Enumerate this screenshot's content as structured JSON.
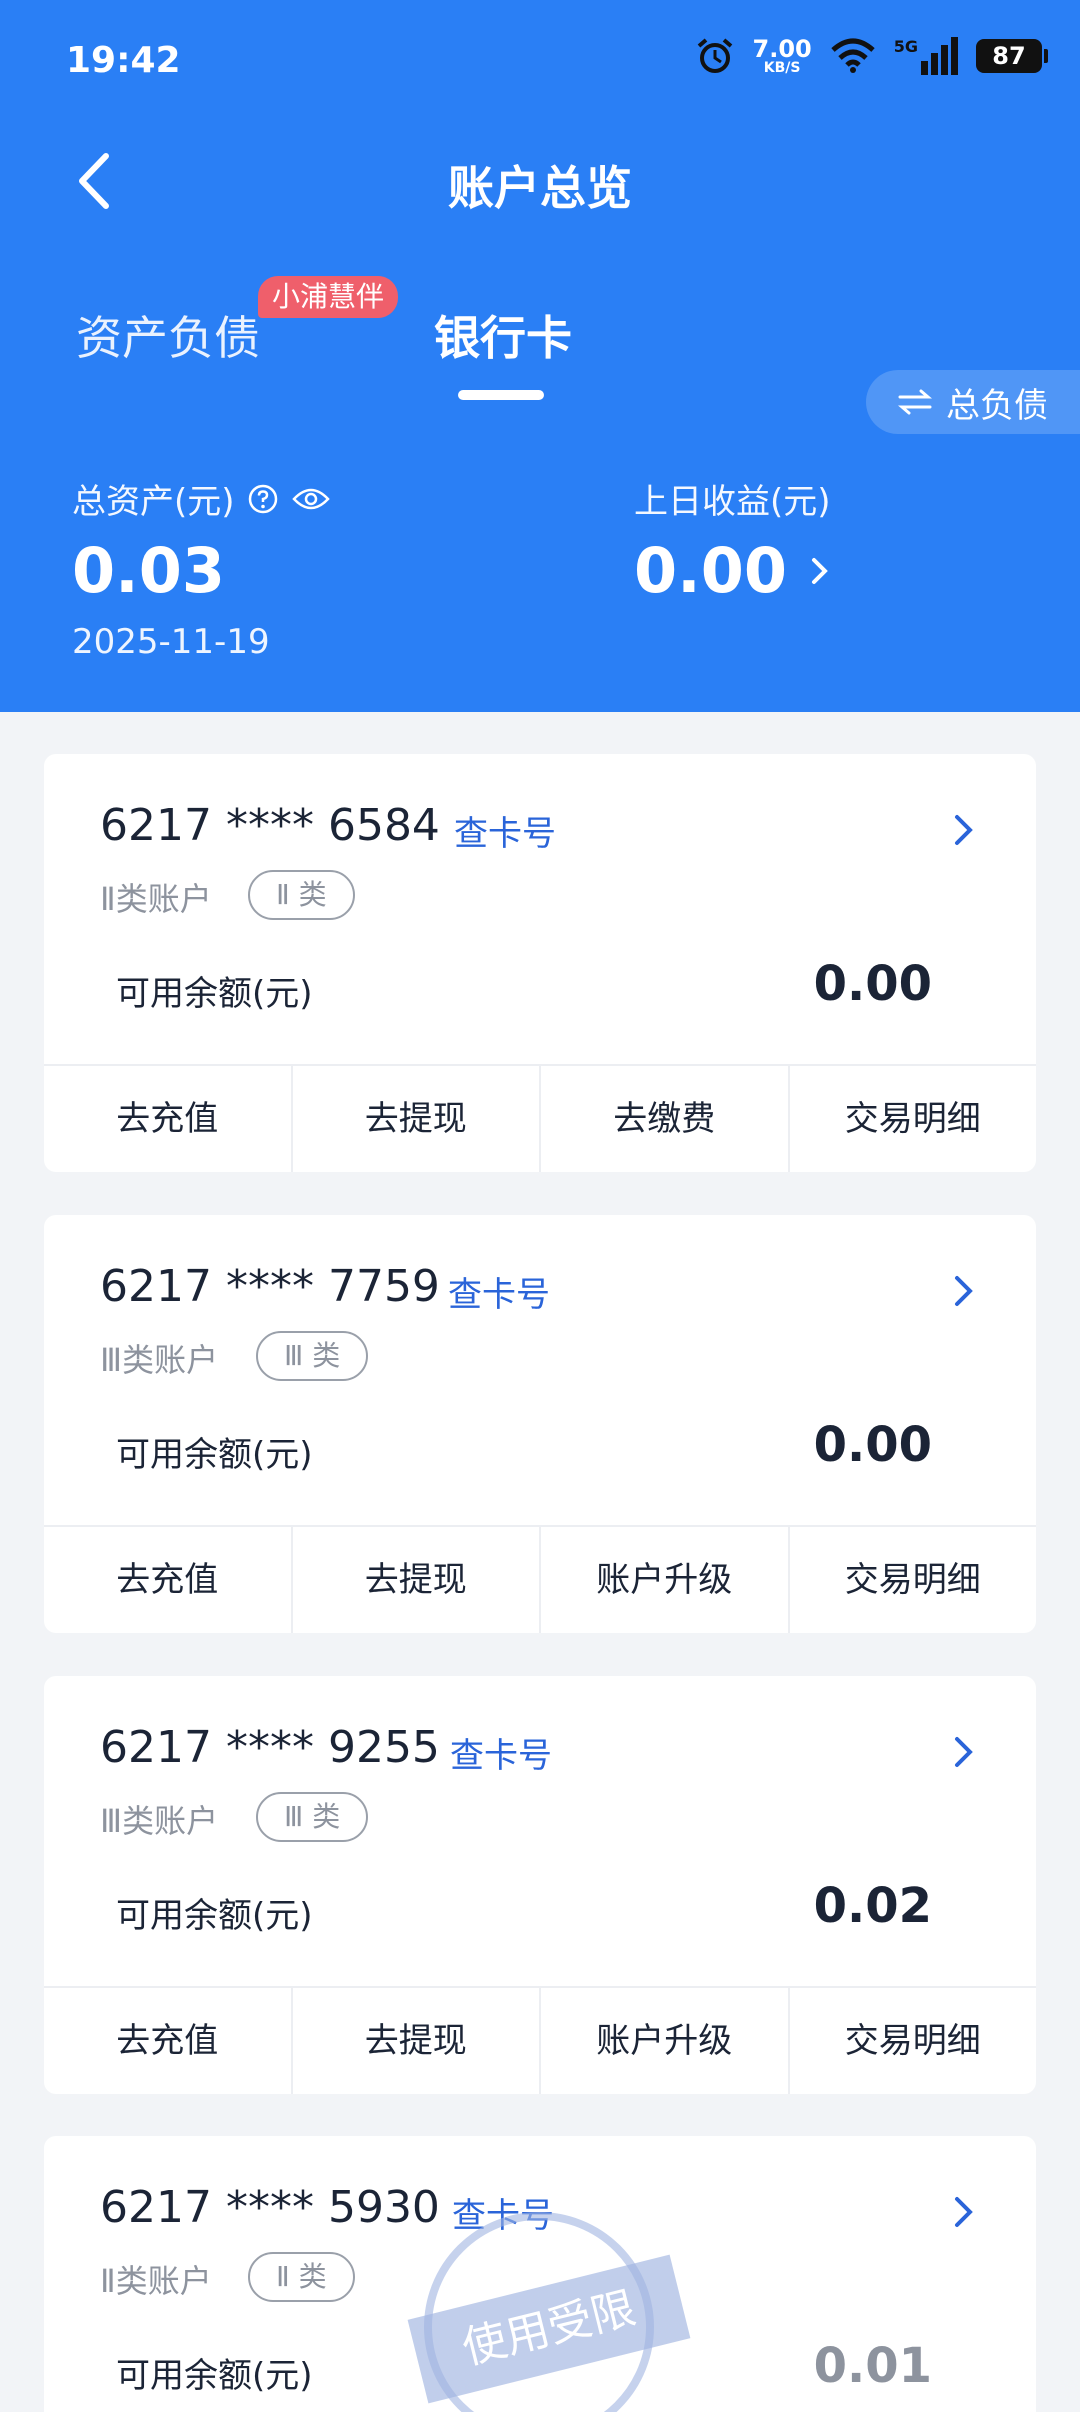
{
  "status_bar": {
    "time": "19:42",
    "speed_value": "7.00",
    "speed_unit": "KB/S",
    "network": "5G",
    "battery": "87"
  },
  "header": {
    "title": "账户总览"
  },
  "tabs": [
    {
      "label": "资产负债",
      "badge": "小浦慧伴"
    },
    {
      "label": "银行卡",
      "active": true
    }
  ],
  "switch_button": {
    "label": "总负债"
  },
  "summary": {
    "total_assets_label": "总资产(元)",
    "total_assets_value": "0.03",
    "date": "2025-11-19",
    "yesterday_label": "上日收益(元)",
    "yesterday_value": "0.00"
  },
  "cards": [
    {
      "number": "6217 **** 6584",
      "view_label": "查卡号",
      "type": "Ⅱ类账户",
      "badge": "Ⅱ 类",
      "avail_label": "可用余额(元)",
      "avail_value": "0.00",
      "actions": [
        "去充值",
        "去提现",
        "去缴费",
        "交易明细"
      ]
    },
    {
      "number": "6217 **** 7759",
      "view_label": "查卡号",
      "type": "Ⅲ类账户",
      "badge": "Ⅲ 类",
      "avail_label": "可用余额(元)",
      "avail_value": "0.00",
      "actions": [
        "去充值",
        "去提现",
        "账户升级",
        "交易明细"
      ]
    },
    {
      "number": "6217 **** 9255",
      "view_label": "查卡号",
      "type": "Ⅲ类账户",
      "badge": "Ⅲ 类",
      "avail_label": "可用余额(元)",
      "avail_value": "0.02",
      "actions": [
        "去充值",
        "去提现",
        "账户升级",
        "交易明细"
      ]
    },
    {
      "number": "6217 **** 5930",
      "view_label": "查卡号",
      "type": "Ⅱ类账户",
      "badge": "Ⅱ 类",
      "avail_label": "可用余额(元)",
      "avail_value": "0.01",
      "stamp": "使用受限"
    }
  ],
  "colors": {
    "primary": "#2a7ff5",
    "link": "#2a64d9",
    "badge_red": "#ef5f6b",
    "muted": "#8d939e",
    "background": "#f2f4f7"
  }
}
